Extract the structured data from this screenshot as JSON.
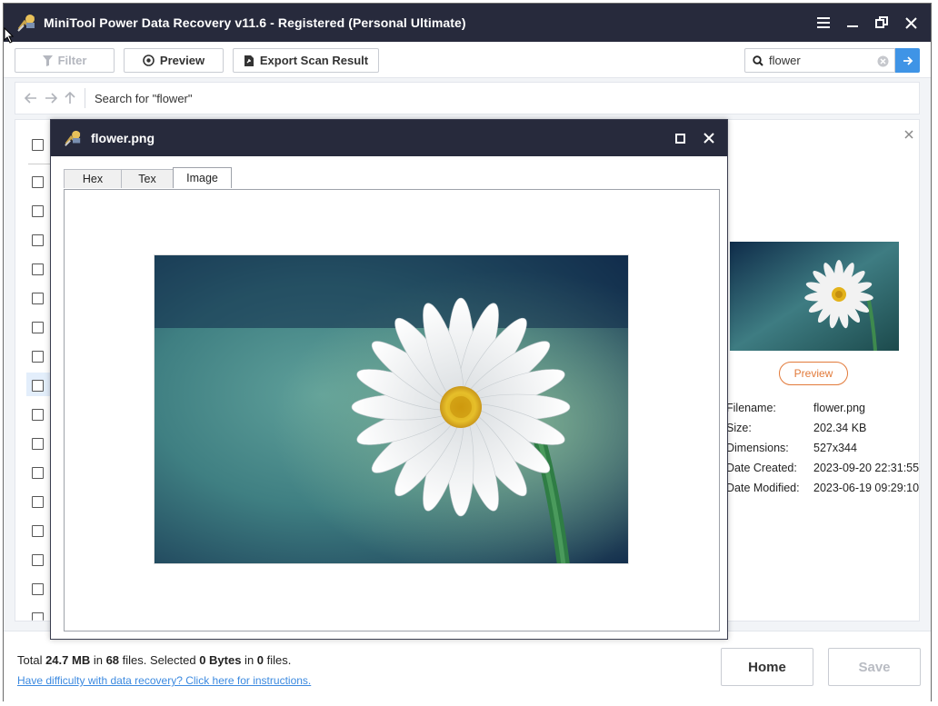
{
  "app": {
    "title": "MiniTool Power Data Recovery v11.6 - Registered (Personal Ultimate)"
  },
  "toolbar": {
    "filter_label": "Filter",
    "preview_label": "Preview",
    "export_label": "Export Scan Result",
    "search_value": "flower"
  },
  "nav": {
    "path_text": "Search for  \"flower\""
  },
  "details": {
    "preview_button": "Preview",
    "props": [
      {
        "key": "Filename:",
        "value": "flower.png"
      },
      {
        "key": "Size:",
        "value": "202.34 KB"
      },
      {
        "key": "Dimensions:",
        "value": "527x344"
      },
      {
        "key": "Date Created:",
        "value": "2023-09-20 22:31:55"
      },
      {
        "key": "Date Modified:",
        "value": "2023-06-19 09:29:10"
      }
    ]
  },
  "dialog": {
    "file_name": "flower.png",
    "tabs": [
      {
        "label": "Hex",
        "active": false
      },
      {
        "label": "Tex",
        "active": false
      },
      {
        "label": "Image",
        "active": true
      }
    ]
  },
  "footer": {
    "total_prefix": "Total ",
    "total_size": "24.7 MB",
    "in_word": " in ",
    "total_files": "68",
    "files_selected_prefix": " files.  Selected ",
    "selected_size": "0 Bytes",
    "in_word2": " in ",
    "selected_files": "0",
    "files_suffix": " files.",
    "help_link": "Have difficulty with data recovery? Click here for instructions.",
    "home_label": "Home",
    "save_label": "Save"
  },
  "colors": {
    "titlebar": "#272a3c",
    "accent_blue": "#3f94e6",
    "accent_orange": "#e27a3a"
  }
}
